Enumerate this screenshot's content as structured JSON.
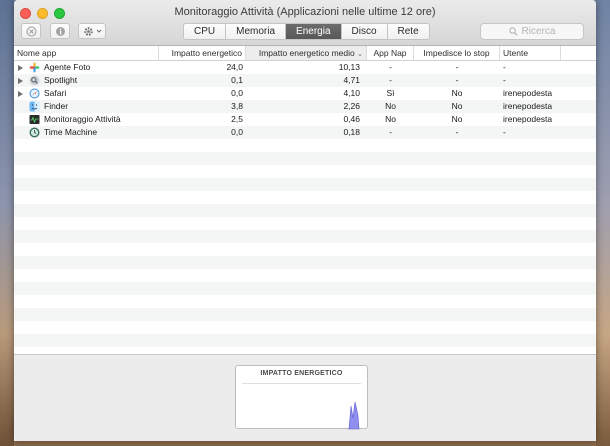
{
  "window": {
    "title": "Monitoraggio Attività (Applicazioni nelle ultime 12 ore)"
  },
  "toolbar": {
    "tabs": [
      {
        "label": "CPU",
        "active": false
      },
      {
        "label": "Memoria",
        "active": false
      },
      {
        "label": "Energia",
        "active": true
      },
      {
        "label": "Disco",
        "active": false
      },
      {
        "label": "Rete",
        "active": false
      }
    ],
    "search_placeholder": "Ricerca"
  },
  "columns": {
    "app": "Nome app",
    "impact": "Impatto energetico",
    "avg": "Impatto energetico medio",
    "sort_indicator": "⌄",
    "appnap": "App Nap",
    "prevent": "Impedisce lo stop",
    "user": "Utente"
  },
  "rows": [
    {
      "expandable": true,
      "icon": "photos-agent-icon",
      "name": "Agente Foto",
      "impact": "24,0",
      "avg": "10,13",
      "appnap": "-",
      "prevent": "-",
      "user": "-"
    },
    {
      "expandable": true,
      "icon": "spotlight-icon",
      "name": "Spotlight",
      "impact": "0,1",
      "avg": "4,71",
      "appnap": "-",
      "prevent": "-",
      "user": "-"
    },
    {
      "expandable": true,
      "icon": "safari-icon",
      "name": "Safari",
      "impact": "0,0",
      "avg": "4,10",
      "appnap": "Sì",
      "prevent": "No",
      "user": "irenepodesta"
    },
    {
      "expandable": false,
      "icon": "finder-icon",
      "name": "Finder",
      "impact": "3,8",
      "avg": "2,26",
      "appnap": "No",
      "prevent": "No",
      "user": "irenepodesta"
    },
    {
      "expandable": false,
      "icon": "activity-monitor-icon",
      "name": "Monitoraggio Attività",
      "impact": "2,5",
      "avg": "0,46",
      "appnap": "No",
      "prevent": "No",
      "user": "irenepodesta"
    },
    {
      "expandable": false,
      "icon": "time-machine-icon",
      "name": "Time Machine",
      "impact": "0,0",
      "avg": "0,18",
      "appnap": "-",
      "prevent": "-",
      "user": "-"
    }
  ],
  "footer": {
    "graph_title": "IMPATTO ENERGETICO",
    "graph_color": "#8f8ff0"
  }
}
